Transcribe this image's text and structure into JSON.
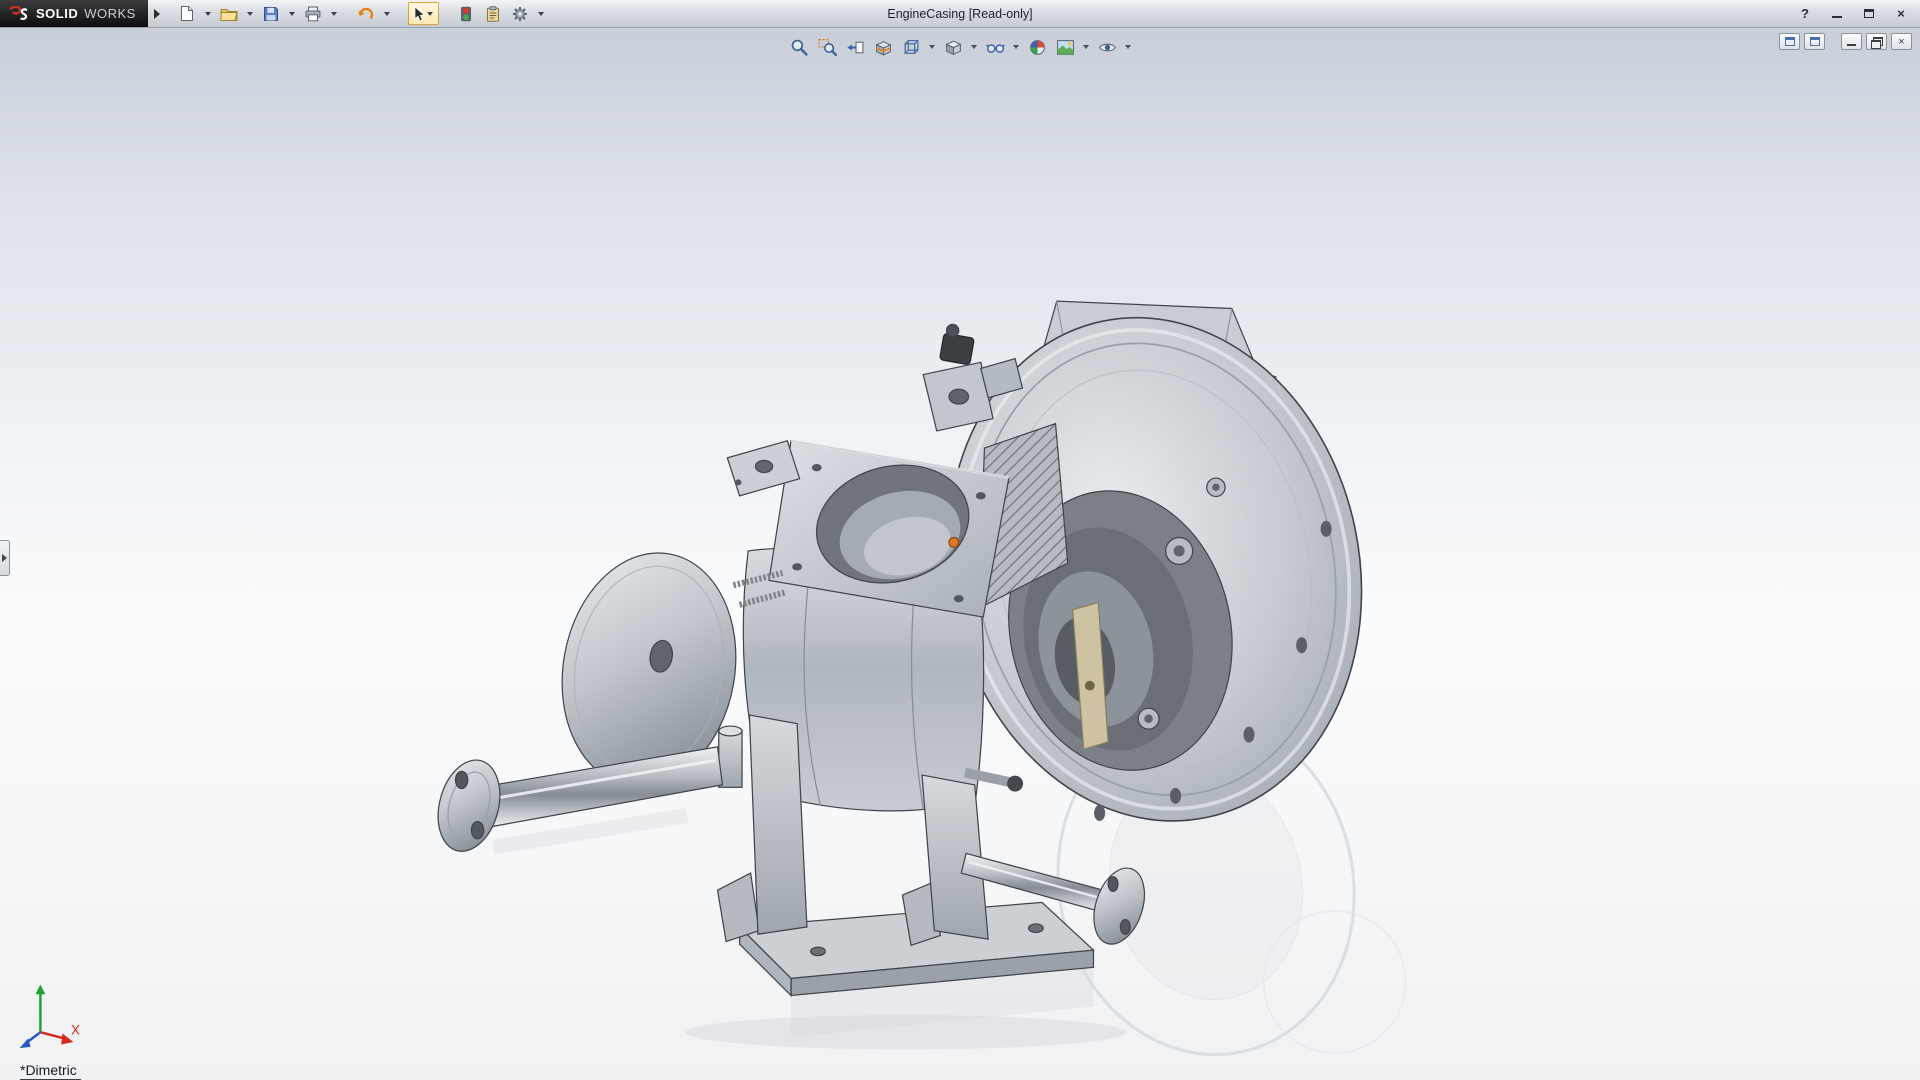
{
  "titlebar": {
    "brand": {
      "bold": "SOLID",
      "light": "WORKS"
    },
    "title": "EngineCasing [Read-only]",
    "controls": {
      "help": "?",
      "minimize": "Minimize",
      "maximize": "Maximize",
      "close": "×"
    }
  },
  "main_toolbar": {
    "items": [
      "New",
      "Open",
      "Save",
      "Print",
      "Undo",
      "Select",
      "Rebuild",
      "File Properties",
      "Options"
    ]
  },
  "headsup_toolbar": {
    "items": [
      "Zoom to Fit",
      "Zoom to Area",
      "Previous View",
      "Section View",
      "View Orientation",
      "Display Style",
      "Hide/Show Items",
      "Edit Appearance",
      "Apply Scene",
      "View Settings"
    ]
  },
  "document_controls": [
    "Pane",
    "Pane",
    "Minimize",
    "Restore",
    "Close"
  ],
  "viewport": {
    "view_label": "*Dimetric",
    "triad": {
      "x_label": "X"
    }
  },
  "colors": {
    "selection_orange": "#e0791f",
    "viewport_gradient_top": "#c9cfd9",
    "viewport_gradient_bottom": "#f0f1f3",
    "titlebar_logo_bg": "#141414",
    "axis_x": "#d42a1e",
    "axis_y": "#1fa12e",
    "axis_z": "#2b56c4"
  }
}
